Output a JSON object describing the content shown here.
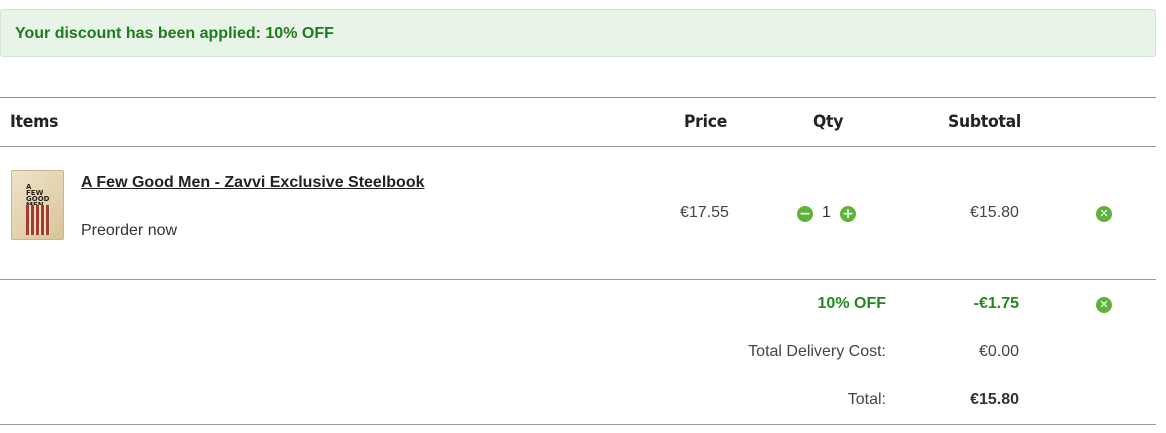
{
  "banner": {
    "message": "Your discount has been applied: 10% OFF"
  },
  "table": {
    "headers": {
      "items": "Items",
      "price": "Price",
      "qty": "Qty",
      "subtotal": "Subtotal"
    },
    "rows": [
      {
        "thumbnail_title": "A FEW GOOD MEN",
        "name": "A Few Good Men - Zavvi Exclusive Steelbook",
        "status": "Preorder now",
        "price": "€17.55",
        "qty": "1",
        "subtotal": "€15.80"
      }
    ]
  },
  "summary": {
    "discount_label": "10% OFF",
    "discount_value": "-€1.75",
    "delivery_label": "Total Delivery Cost:",
    "delivery_value": "€0.00",
    "total_label": "Total:",
    "total_value": "€15.80"
  },
  "icons": {
    "qty_minus": "minus-circle-icon",
    "qty_plus": "plus-circle-icon",
    "remove": "close-circle-icon"
  },
  "colors": {
    "accent_green": "#5fb33a",
    "discount_text": "#1f8a1f",
    "banner_bg": "#e8f4e7"
  }
}
